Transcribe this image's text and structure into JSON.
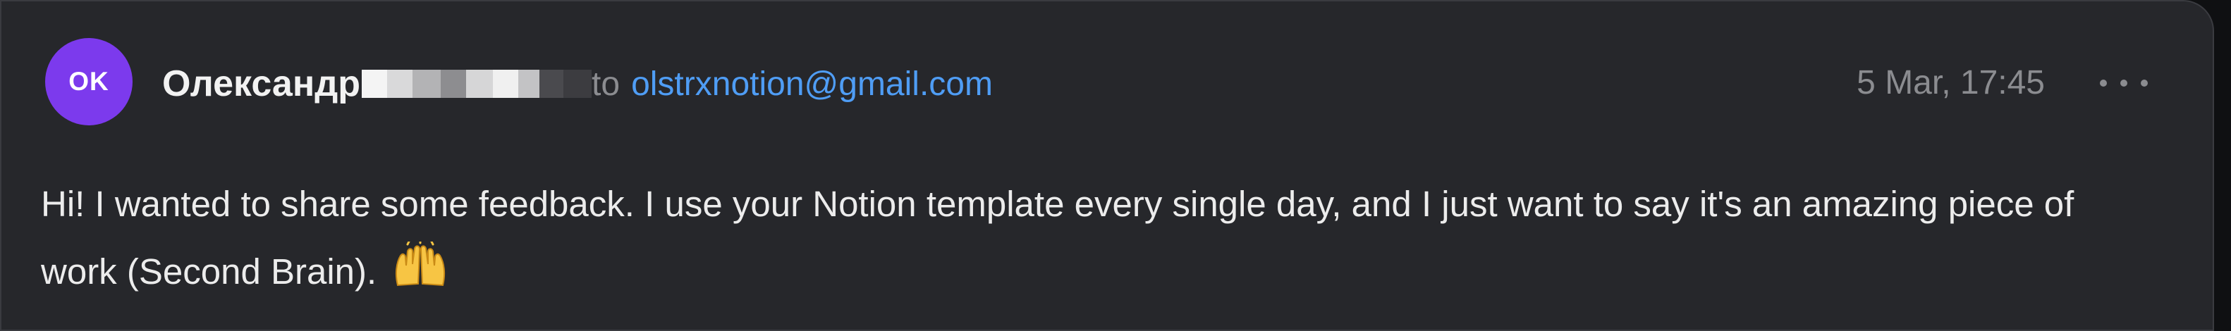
{
  "message": {
    "avatar_initials": "OK",
    "avatar_color": "#7c3aed",
    "sender_name": "Олександр",
    "to_label": "to",
    "recipient_email": "olstrxnotion@gmail.com",
    "timestamp": "5 Mar, 17:45",
    "body_text": "Hi! I wanted to share some feedback. I use your Notion template every single day, and I just want to say it's an amazing piece of work (Second Brain).",
    "body_emoji": "raising-hands-emoji",
    "more_icon": "more-horizontal-icon"
  },
  "colors": {
    "background": "#26272b",
    "link": "#4f9df5",
    "muted": "#8b8c90",
    "text": "#ececec"
  }
}
